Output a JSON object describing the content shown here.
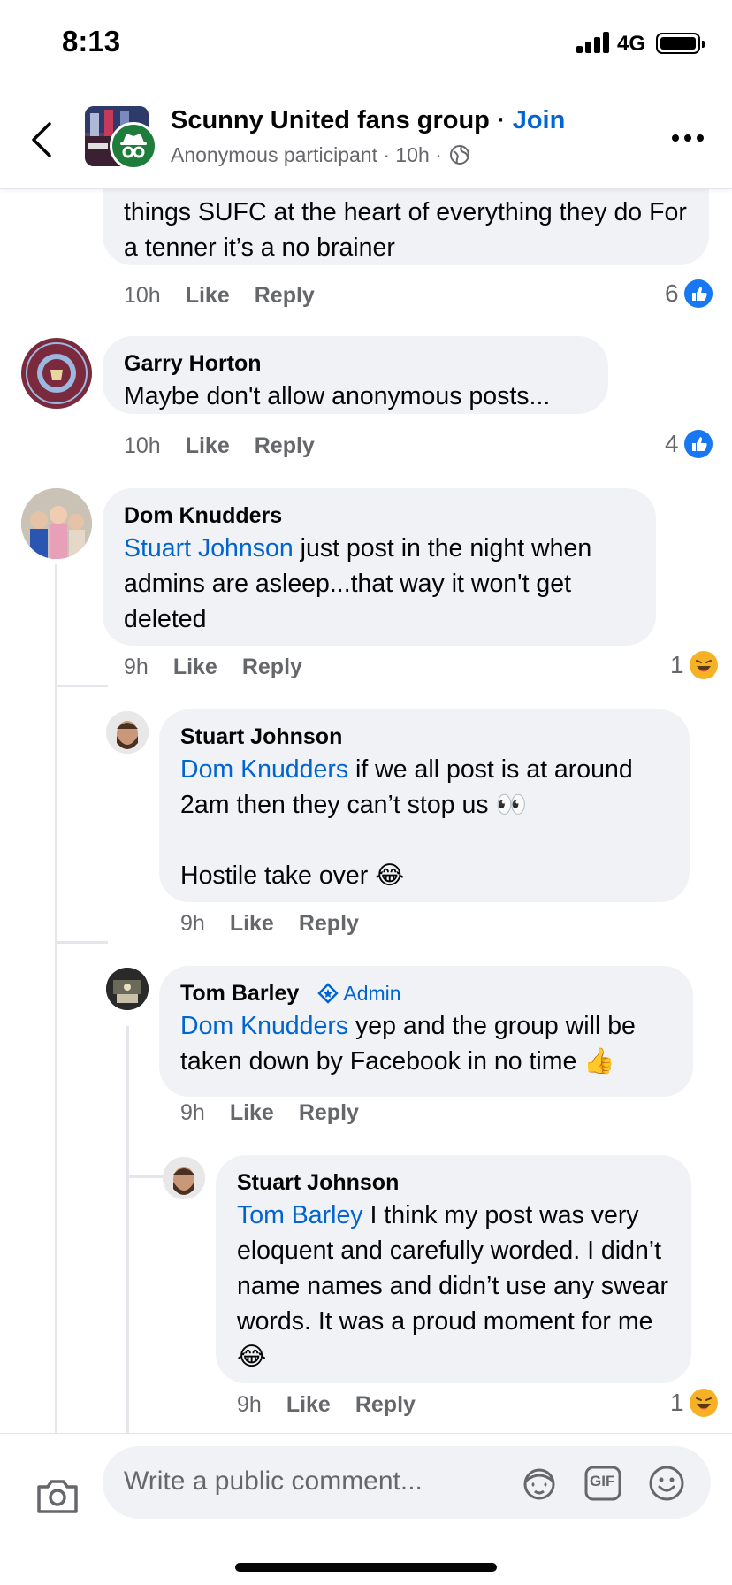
{
  "status_bar": {
    "time": "8:13",
    "network": "4G"
  },
  "header": {
    "group_name": "Scunny United fans group",
    "separator": "·",
    "join_label": "Join",
    "subtitle": "Anonymous participant · 10h ·"
  },
  "comments": [
    {
      "id": "c0",
      "text": "things SUFC at the heart of everything they do For a tenner it’s a no brainer",
      "time": "10h",
      "like_label": "Like",
      "reply_label": "Reply",
      "reaction_count": "6",
      "reaction_type": "like"
    },
    {
      "id": "c1",
      "author": "Garry Horton",
      "avatar_text_top": "125 YEARS",
      "avatar_text_club": "SCUNTHORPE UNITED",
      "avatar_text_bottom": "THE IRON",
      "text": "Maybe don't allow anonymous posts...",
      "time": "10h",
      "like_label": "Like",
      "reply_label": "Reply",
      "reaction_count": "4",
      "reaction_type": "like"
    },
    {
      "id": "c2",
      "author": "Dom Knudders",
      "mention": "Stuart Johnson",
      "text": " just post in the night when admins are asleep...that way it won't get deleted",
      "time": "9h",
      "like_label": "Like",
      "reply_label": "Reply",
      "reaction_count": "1",
      "reaction_type": "haha"
    },
    {
      "id": "c3",
      "author": "Stuart Johnson",
      "mention": "Dom Knudders",
      "text": " if we all post is at around 2am then they can’t stop us 👀",
      "text2": "Hostile take over 😂",
      "time": "9h",
      "like_label": "Like",
      "reply_label": "Reply"
    },
    {
      "id": "c4",
      "author": "Tom Barley",
      "badge": "Admin",
      "mention": "Dom Knudders",
      "text": " yep and the group will be taken down by Facebook in no time 👍",
      "time": "9h",
      "like_label": "Like",
      "reply_label": "Reply"
    },
    {
      "id": "c5",
      "author": "Stuart Johnson",
      "mention": "Tom Barley",
      "text": " I think my post was very eloquent and carefully worded. I didn’t name names and didn’t use any swear words. It was a proud moment for me 😂",
      "time": "9h",
      "like_label": "Like",
      "reply_label": "Reply",
      "reaction_count": "1",
      "reaction_type": "haha"
    }
  ],
  "composer": {
    "placeholder": "Write a public comment...",
    "gif_label": "GIF"
  },
  "colors": {
    "link_blue": "#0064d1",
    "like_blue": "#1877f2",
    "bubble_gray": "#f0f2f5",
    "meta_gray": "#65676b"
  },
  "icons": [
    "back-chevron-icon",
    "anonymous-icon",
    "globe-icon",
    "more-icon",
    "like-reaction-icon",
    "haha-reaction-icon",
    "admin-badge-icon",
    "camera-icon",
    "avatar-sticker-icon",
    "gif-icon",
    "emoji-icon"
  ]
}
